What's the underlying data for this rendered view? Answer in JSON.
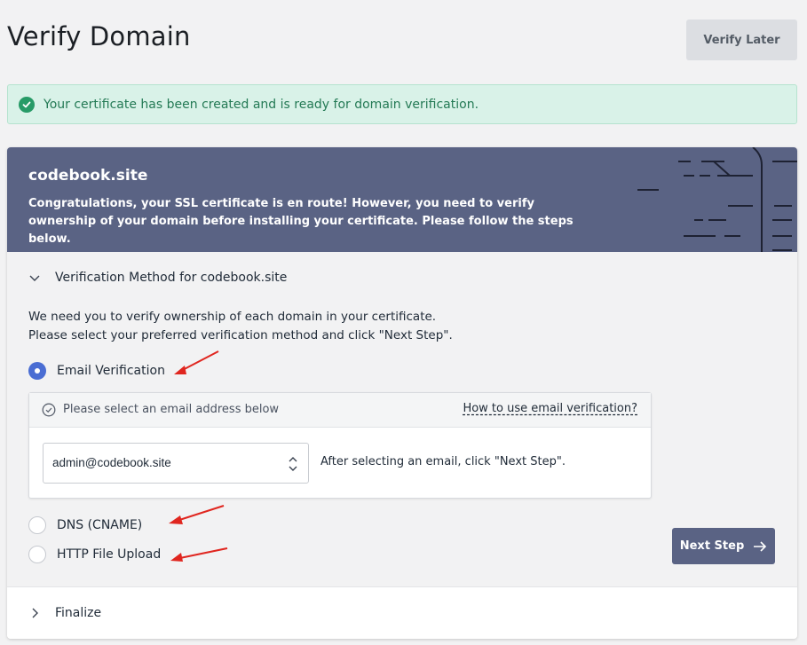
{
  "page": {
    "title": "Verify Domain"
  },
  "actions": {
    "verify_later_label": "Verify Later"
  },
  "alert": {
    "message": "Your certificate has been created and is ready for domain verification.",
    "icon": "check-circle-icon",
    "color": "#279b67"
  },
  "card": {
    "domain": "codebook.site",
    "description": "Congratulations, your SSL certificate is en route! However, you need to verify ownership of your domain before installing your certificate. Please follow the steps below.",
    "header_color": "#5a6384"
  },
  "verification": {
    "section_title": "Verification Method for codebook.site",
    "instructions_line1": "We need you to verify ownership of each domain in your certificate.",
    "instructions_line2": "Please select your preferred verification method and click \"Next Step\".",
    "options": [
      {
        "label": "Email Verification",
        "selected": true
      },
      {
        "label": "DNS (CNAME)",
        "selected": false
      },
      {
        "label": "HTTP File Upload",
        "selected": false
      }
    ],
    "email": {
      "hint": "Please select an email address below",
      "howto_link": "How to use email verification?",
      "selected_email": "admin@codebook.site",
      "after_note": "After selecting an email, click \"Next Step\"."
    },
    "next_step_label": "Next Step",
    "accent_color": "#4a6dd3"
  },
  "finalize": {
    "label": "Finalize"
  }
}
